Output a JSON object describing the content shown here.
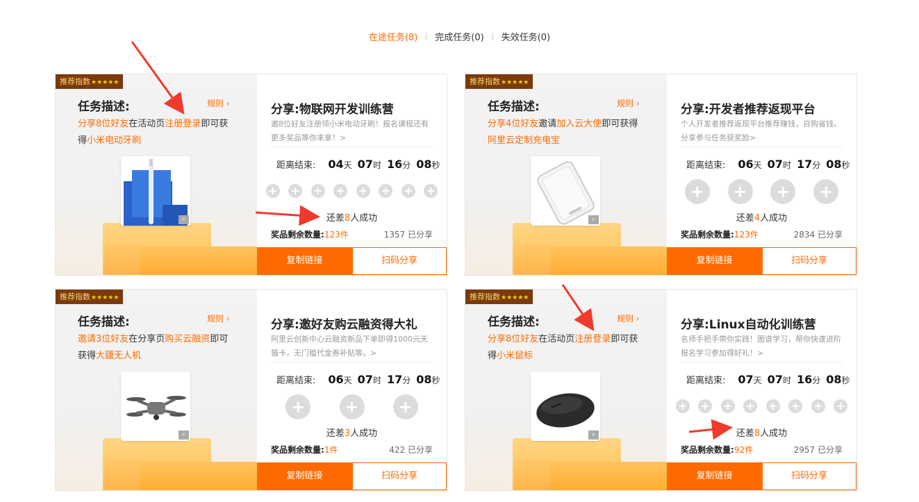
{
  "tabs": [
    {
      "label": "在途任务(8)",
      "active": true
    },
    {
      "label": "完成任务(0)",
      "active": false
    },
    {
      "label": "失效任务(0)",
      "active": false
    }
  ],
  "accent_color": "#ff6a00",
  "common": {
    "badge": "推荐指数",
    "stars": "★★★★★",
    "desc_title": "任务描述:",
    "rule": "规则 ›",
    "countdown_label": "距离结束:",
    "unit_day": "天",
    "unit_hour": "时",
    "unit_min": "分",
    "unit_sec": "秒",
    "remain_prefix": "还差",
    "remain_suffix": "人成功",
    "stock_label": "奖品剩余数量:",
    "copy_btn": "复制链接",
    "scan_btn": "扫码分享",
    "zoom_icon": "magnifier-icon"
  },
  "cards": [
    {
      "desc": [
        {
          "t": "分享8位好友",
          "hl": true
        },
        {
          "t": "在活动页",
          "hl": false
        },
        {
          "t": "注册登录",
          "hl": true
        },
        {
          "t": "即可获得",
          "hl": false
        },
        {
          "t": "小米电动牙刷",
          "hl": true
        }
      ],
      "product": "toothbrush",
      "title": "分享:物联网开发训练营",
      "subtitle": "邀8位好友注册领小米电动牙刷！报名课程还有更多奖品等你来拿！>",
      "d": "04",
      "h": "07",
      "m": "16",
      "s": "08",
      "slots": 8,
      "remain": "8",
      "stock": "123件",
      "shared": "1357 已分享"
    },
    {
      "desc": [
        {
          "t": "分享4位好友",
          "hl": true
        },
        {
          "t": "邀请",
          "hl": false
        },
        {
          "t": "加入云大使",
          "hl": true
        },
        {
          "t": "即可获得",
          "hl": false
        },
        {
          "t": "阿里云定制充电宝",
          "hl": true
        }
      ],
      "product": "powerbank",
      "title": "分享:开发者推荐返现平台",
      "subtitle": "个人开发者推荐返现平台推荐赚钱，自购省钱。分享参与任务获奖励>",
      "d": "06",
      "h": "07",
      "m": "17",
      "s": "08",
      "slots": 4,
      "remain": "4",
      "stock": "123件",
      "shared": "2834 已分享"
    },
    {
      "desc": [
        {
          "t": "邀请3位好友",
          "hl": true
        },
        {
          "t": "在分享页",
          "hl": false
        },
        {
          "t": "购买云融资",
          "hl": true
        },
        {
          "t": "即可获得",
          "hl": false
        },
        {
          "t": "大疆无人机",
          "hl": true
        }
      ],
      "product": "drone",
      "title": "分享:邀好友购云融资得大礼",
      "subtitle": "阿里云创新中心云融资新品下单即得1000元天猫卡，无门槛代金券补贴等。>",
      "d": "06",
      "h": "07",
      "m": "17",
      "s": "08",
      "slots": 3,
      "remain": "3",
      "stock": "1件",
      "shared": "422 已分享"
    },
    {
      "desc": [
        {
          "t": "分享8位好友",
          "hl": true
        },
        {
          "t": "在活动页",
          "hl": false
        },
        {
          "t": "注册登录",
          "hl": true
        },
        {
          "t": "即可获得",
          "hl": false
        },
        {
          "t": "小米鼠标",
          "hl": true
        }
      ],
      "product": "mouse",
      "title": "分享:Linux自动化训练营",
      "subtitle": "名师手把手带你实践！图谱学习，帮你快速进阶报名学习参加得好礼！>",
      "d": "07",
      "h": "07",
      "m": "16",
      "s": "08",
      "slots": 8,
      "remain": "8",
      "stock": "92件",
      "shared": "2957 已分享"
    }
  ]
}
